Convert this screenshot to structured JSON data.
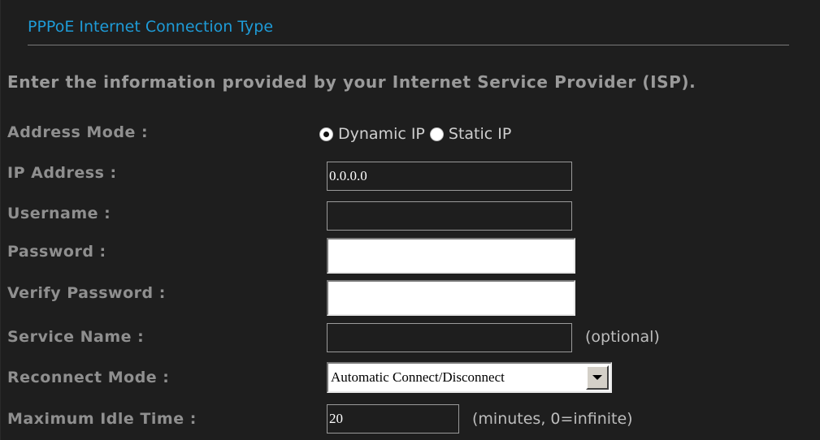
{
  "section": {
    "title": "PPPoE Internet Connection Type"
  },
  "instructions": "Enter the information provided by your Internet Service Provider (ISP).",
  "form": {
    "address_mode": {
      "label": "Address Mode :",
      "options": [
        {
          "label": "Dynamic IP",
          "checked": true
        },
        {
          "label": "Static IP",
          "checked": false
        }
      ]
    },
    "ip_address": {
      "label": "IP Address :",
      "value": "0.0.0.0"
    },
    "username": {
      "label": "Username :",
      "value": ""
    },
    "password": {
      "label": "Password :",
      "value": ""
    },
    "verify_password": {
      "label": "Verify Password :",
      "value": ""
    },
    "service_name": {
      "label": "Service Name :",
      "value": "",
      "hint": "(optional)"
    },
    "reconnect_mode": {
      "label": "Reconnect Mode :",
      "selected": "Automatic Connect/Disconnect"
    },
    "max_idle_time": {
      "label": "Maximum Idle Time :",
      "value": "20",
      "hint": "(minutes, 0=infinite)"
    }
  },
  "colors": {
    "background": "#1e1e1e",
    "title": "#1e9bd7",
    "label": "#8f8f8f"
  }
}
